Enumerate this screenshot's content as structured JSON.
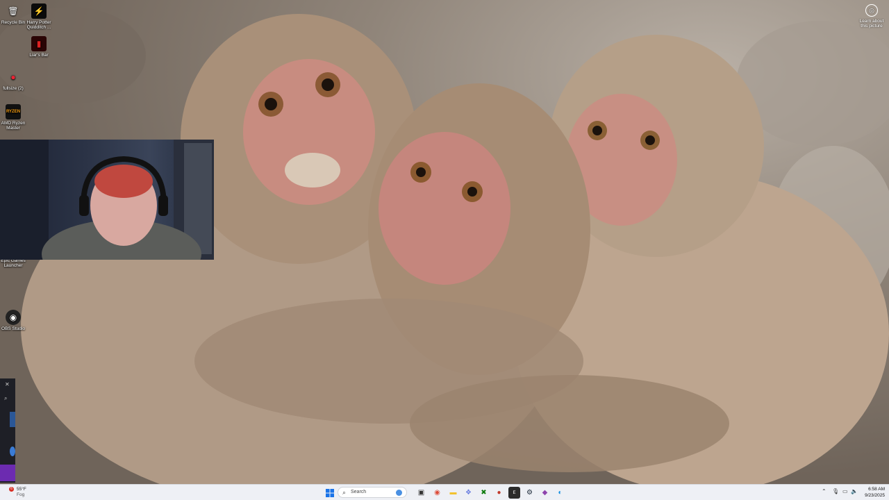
{
  "desktop": {
    "icons": [
      {
        "label": "Recycle Bin",
        "icon": "recycle-bin-icon"
      },
      {
        "label": "Harry Potter Quidditch ...",
        "icon": "harry-potter-game-icon"
      },
      {
        "label": "Liar's Bar",
        "icon": "liars-bar-icon"
      },
      {
        "label": "fullsize (2)",
        "icon": "mario-icon"
      },
      {
        "label": "AMD Ryzen Master",
        "icon": "ryzen-master-icon"
      },
      {
        "label": "Epic Games Launcher",
        "icon": "epic-games-icon"
      },
      {
        "label": "OBS Studio",
        "icon": "obs-studio-icon"
      }
    ],
    "learn_about_picture": "Learn about this picture"
  },
  "taskbar": {
    "weather": {
      "temp": "55°F",
      "condition": "Fog",
      "badge": "6"
    },
    "start_icon": "windows-start-icon",
    "search_placeholder": "Search",
    "pinned": [
      {
        "name": "task-view",
        "icon": "task-view-icon",
        "color": "#3b3b3b"
      },
      {
        "name": "chrome",
        "icon": "chrome-icon",
        "color": "#dd4b39"
      },
      {
        "name": "file-explorer",
        "icon": "folder-icon",
        "color": "#f2c230"
      },
      {
        "name": "copilot",
        "icon": "copilot-icon",
        "color": "#6b7fe0"
      },
      {
        "name": "xbox",
        "icon": "xbox-icon",
        "color": "#107c10"
      },
      {
        "name": "app-red",
        "icon": "recorder-icon",
        "color": "#c0392b"
      },
      {
        "name": "epic",
        "icon": "epic-games-icon",
        "color": "#2b2b2b"
      },
      {
        "name": "steam",
        "icon": "steam-icon",
        "color": "#1b2838"
      },
      {
        "name": "app-purple",
        "icon": "app-purple-icon",
        "color": "#8e44ad"
      },
      {
        "name": "edge",
        "icon": "edge-icon",
        "color": "#0c8ce0"
      }
    ],
    "time": "6:58 AM",
    "date": "9/23/2025"
  }
}
